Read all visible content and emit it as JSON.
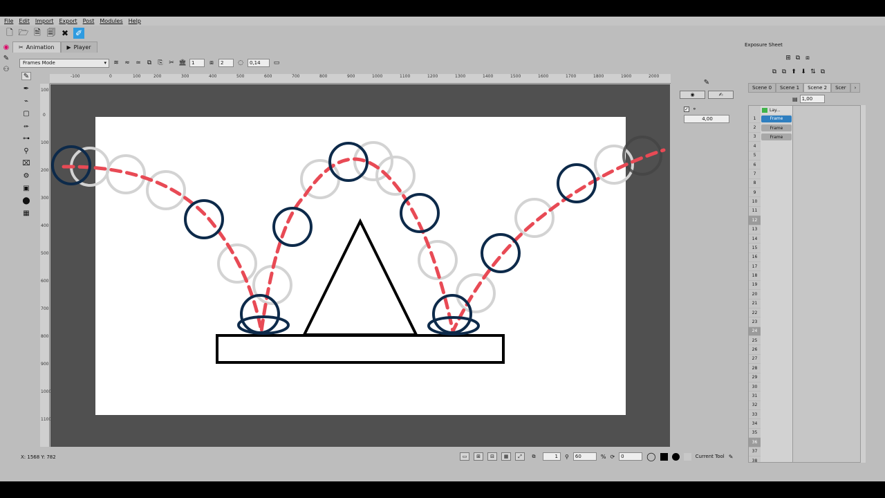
{
  "menu": [
    "File",
    "Edit",
    "Import",
    "Export",
    "Post",
    "Modules",
    "Help"
  ],
  "tabs": {
    "animation": "Animation",
    "player": "Player"
  },
  "animation_toolbar": {
    "mode": "Frames Mode",
    "value1": "1",
    "value2": "2",
    "opacity": "0,14"
  },
  "rulers": {
    "h": [
      "-100",
      "0",
      "100",
      "200",
      "300",
      "400",
      "500",
      "600",
      "700",
      "800",
      "900",
      "1000",
      "1100",
      "1200",
      "1300",
      "1400",
      "1500",
      "1600",
      "1700",
      "1800",
      "1900",
      "2000"
    ],
    "v": [
      "100",
      "0",
      "100",
      "200",
      "300",
      "400",
      "500",
      "600",
      "700",
      "800",
      "900",
      "1000",
      "1100"
    ]
  },
  "status": {
    "coords": "X: 1568 Y: 782"
  },
  "bottom_bar": {
    "frame": "1",
    "zoom": "60",
    "percent": "%",
    "rotation": "0",
    "current_tool": "Current Tool"
  },
  "tool_options": {
    "value": "4,00"
  },
  "exposure_sheet": {
    "title": "Exposure Sheet",
    "opacity": "1,00",
    "scenes": [
      "Scene 0",
      "Scene 1",
      "Scene 2",
      "Scer"
    ],
    "active_scene": "Scene 2",
    "layer": "Lay...",
    "frames": [
      "Frame",
      "Frame",
      "Frame"
    ],
    "rows": [
      "1",
      "2",
      "3",
      "4",
      "5",
      "6",
      "7",
      "8",
      "9",
      "10",
      "11",
      "12",
      "13",
      "14",
      "15",
      "16",
      "17",
      "18",
      "19",
      "20",
      "21",
      "22",
      "23",
      "24",
      "25",
      "26",
      "27",
      "28",
      "29",
      "30",
      "31",
      "32",
      "33",
      "34",
      "35",
      "36",
      "37",
      "38"
    ],
    "marked_rows": [
      "12",
      "24",
      "36"
    ]
  },
  "colors": {
    "accent": "#2f7fc0",
    "trajectory": "#e84a55",
    "ball": "#0d2a4a",
    "ghost": "#d3d3d3"
  }
}
